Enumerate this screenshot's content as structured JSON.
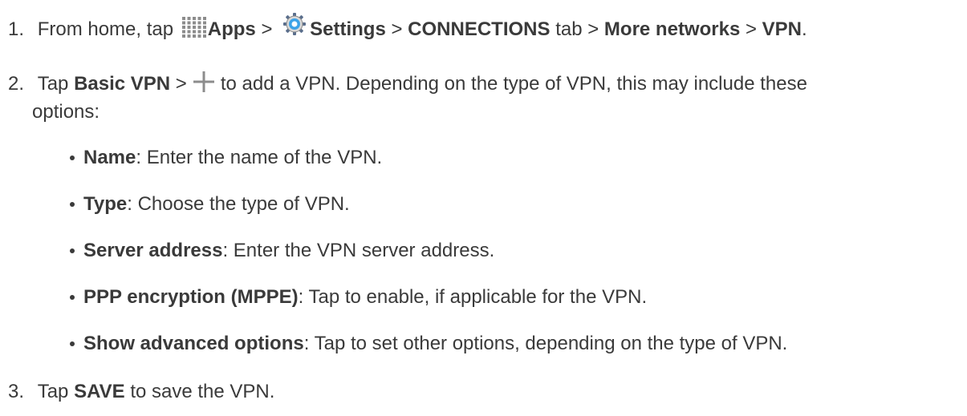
{
  "step1": {
    "number": "1.",
    "pre": "From home, tap",
    "apps": "Apps",
    "sep": ">",
    "settings": "Settings",
    "connections": "CONNECTIONS",
    "tab_word": "tab",
    "more_networks": "More networks",
    "vpn": "VPN",
    "end": "."
  },
  "step2": {
    "number": "2.",
    "tap": "Tap",
    "basic_vpn": "Basic VPN",
    "sep": ">",
    "rest_line1": "to add a VPN. Depending on the type of VPN, this may include these",
    "line2": "options:"
  },
  "options": [
    {
      "label": "Name",
      "desc": ": Enter the name of the VPN."
    },
    {
      "label": "Type",
      "desc": ": Choose the type of VPN."
    },
    {
      "label": "Server address",
      "desc": ": Enter the VPN server address."
    },
    {
      "label": "PPP encryption (MPPE)",
      "desc": ": Tap to enable, if applicable for the VPN."
    },
    {
      "label": "Show advanced options",
      "desc": ": Tap to set other options, depending on the type of VPN."
    }
  ],
  "step3": {
    "number": "3.",
    "tap": "Tap",
    "save": "SAVE",
    "rest": "to save the VPN."
  },
  "icons": {
    "apps": "apps-grid-icon",
    "settings": "settings-gear-icon",
    "add": "plus-icon"
  }
}
